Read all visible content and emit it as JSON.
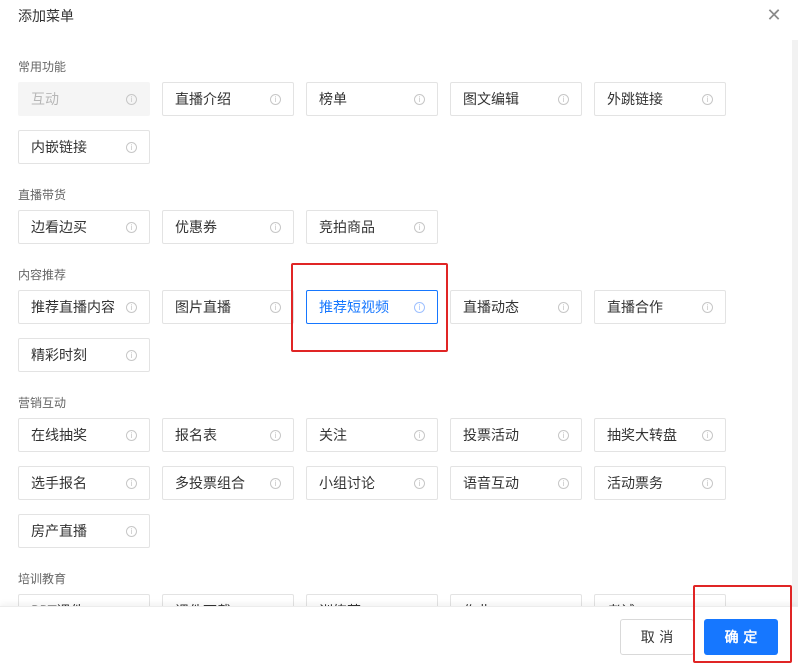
{
  "dialog": {
    "title": "添加菜单",
    "close_icon": "close-icon",
    "info_glyph": "i"
  },
  "sections": [
    {
      "title": "常用功能",
      "items": [
        {
          "label": "互动",
          "state": "disabled"
        },
        {
          "label": "直播介绍"
        },
        {
          "label": "榜单"
        },
        {
          "label": "图文编辑"
        },
        {
          "label": "外跳链接"
        },
        {
          "label": "内嵌链接"
        }
      ]
    },
    {
      "title": "直播带货",
      "items": [
        {
          "label": "边看边买"
        },
        {
          "label": "优惠券"
        },
        {
          "label": "竞拍商品"
        }
      ]
    },
    {
      "title": "内容推荐",
      "items": [
        {
          "label": "推荐直播内容"
        },
        {
          "label": "图片直播"
        },
        {
          "label": "推荐短视频",
          "state": "selected"
        },
        {
          "label": "直播动态"
        },
        {
          "label": "直播合作"
        },
        {
          "label": "精彩时刻"
        }
      ]
    },
    {
      "title": "营销互动",
      "items": [
        {
          "label": "在线抽奖"
        },
        {
          "label": "报名表"
        },
        {
          "label": "关注"
        },
        {
          "label": "投票活动"
        },
        {
          "label": "抽奖大转盘"
        },
        {
          "label": "选手报名"
        },
        {
          "label": "多投票组合"
        },
        {
          "label": "小组讨论"
        },
        {
          "label": "语音互动"
        },
        {
          "label": "活动票务"
        },
        {
          "label": "房产直播"
        }
      ]
    },
    {
      "title": "培训教育",
      "items": [
        {
          "label": "PPT课件"
        },
        {
          "label": "课件下载"
        },
        {
          "label": "训练营"
        },
        {
          "label": "作业"
        },
        {
          "label": "考试"
        }
      ]
    }
  ],
  "footer": {
    "cancel_label": "取 消",
    "ok_label": "确 定"
  },
  "colors": {
    "primary": "#1677ff",
    "highlight": "#e02525"
  }
}
